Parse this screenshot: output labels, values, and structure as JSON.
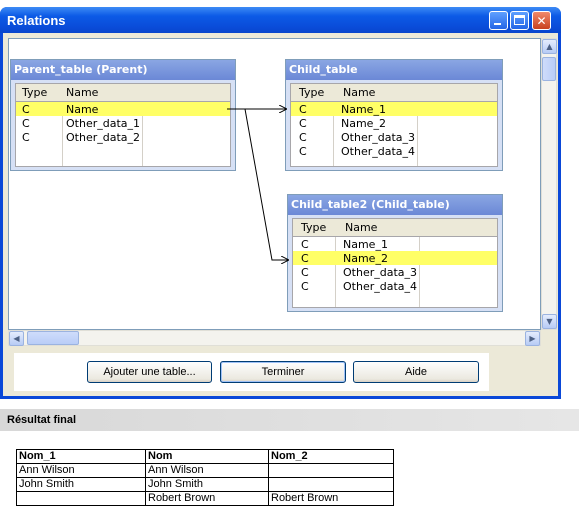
{
  "window": {
    "title": "Relations"
  },
  "tables": {
    "parent": {
      "title": "Parent_table (Parent)",
      "headers": [
        "Type",
        "Name"
      ],
      "rows": [
        {
          "type": "C",
          "name": "Name",
          "selected": true
        },
        {
          "type": "C",
          "name": "Other_data_1",
          "selected": false
        },
        {
          "type": "C",
          "name": "Other_data_2",
          "selected": false
        }
      ]
    },
    "child": {
      "title": "Child_table",
      "headers": [
        "Type",
        "Name"
      ],
      "rows": [
        {
          "type": "C",
          "name": "Name_1",
          "selected": true
        },
        {
          "type": "C",
          "name": "Name_2",
          "selected": false
        },
        {
          "type": "C",
          "name": "Other_data_3",
          "selected": false
        },
        {
          "type": "C",
          "name": "Other_data_4",
          "selected": false
        }
      ]
    },
    "child2": {
      "title": "Child_table2 (Child_table)",
      "headers": [
        "Type",
        "Name"
      ],
      "rows": [
        {
          "type": "C",
          "name": "Name_1",
          "selected": false
        },
        {
          "type": "C",
          "name": "Name_2",
          "selected": true
        },
        {
          "type": "C",
          "name": "Other_data_3",
          "selected": false
        },
        {
          "type": "C",
          "name": "Other_data_4",
          "selected": false
        }
      ]
    }
  },
  "buttons": {
    "add_table": "Ajouter une table...",
    "finish": "Terminer",
    "help": "Aide"
  },
  "result": {
    "title": "Résultat final",
    "headers": [
      "Nom_1",
      "Nom",
      "Nom_2"
    ],
    "rows": [
      [
        "Ann Wilson",
        "Ann Wilson",
        ""
      ],
      [
        "John Smith",
        "John Smith",
        ""
      ],
      [
        "",
        "Robert Brown",
        "Robert Brown"
      ]
    ]
  },
  "colors": {
    "titlebar": "#0a4bd8",
    "selected_row": "#ffff66",
    "table_header": "#7b96dc"
  }
}
